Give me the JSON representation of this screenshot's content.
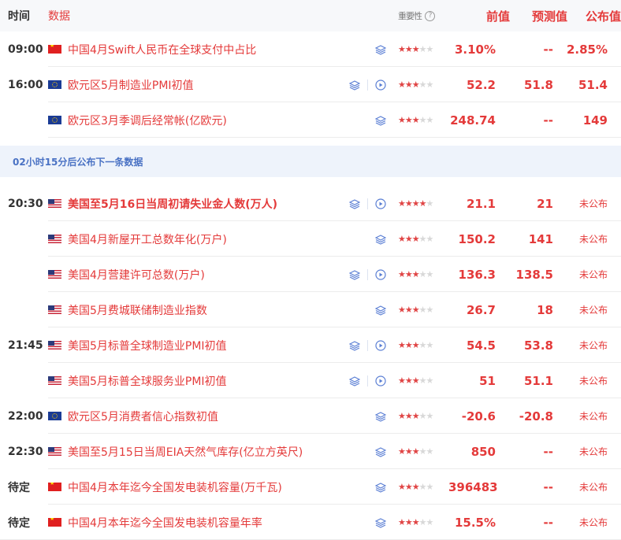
{
  "header": {
    "time": "时间",
    "data": "数据",
    "importance": "重要性",
    "importance_help": "?",
    "previous": "前值",
    "forecast": "预测值",
    "actual": "公布值"
  },
  "colors": {
    "accent_red": "#e43a3a",
    "banner_blue": "#4a72c4",
    "icon_blue": "#5b7fd4"
  },
  "group1": [
    {
      "time": "09:00",
      "flag": "cn",
      "name": "中国4月Swift人民币在全球支付中占比",
      "video": false,
      "stars": 3,
      "prev": "3.10%",
      "forecast": "--",
      "actual": "2.85%",
      "pending": false
    },
    {
      "time": "16:00",
      "flag": "eu",
      "name": "欧元区5月制造业PMI初值",
      "video": true,
      "stars": 3,
      "prev": "52.2",
      "forecast": "51.8",
      "actual": "51.4",
      "pending": false
    },
    {
      "time": "",
      "flag": "eu",
      "name": "欧元区3月季调后经常帐(亿欧元)",
      "video": false,
      "stars": 3,
      "prev": "248.74",
      "forecast": "--",
      "actual": "149",
      "pending": false
    }
  ],
  "banner": "02小时15分后公布下一条数据",
  "group2": [
    {
      "time": "20:30",
      "flag": "us",
      "name": "美国至5月16日当周初请失业金人数(万人)",
      "bold": true,
      "video": true,
      "stars": 4,
      "prev": "21.1",
      "forecast": "21",
      "actual": "未公布",
      "pending": true
    },
    {
      "time": "",
      "flag": "us",
      "name": "美国4月新屋开工总数年化(万户)",
      "video": false,
      "stars": 3,
      "prev": "150.2",
      "forecast": "141",
      "actual": "未公布",
      "pending": true
    },
    {
      "time": "",
      "flag": "us",
      "name": "美国4月营建许可总数(万户)",
      "video": true,
      "stars": 3,
      "prev": "136.3",
      "forecast": "138.5",
      "actual": "未公布",
      "pending": true
    },
    {
      "time": "",
      "flag": "us",
      "name": "美国5月费城联储制造业指数",
      "video": false,
      "stars": 3,
      "prev": "26.7",
      "forecast": "18",
      "actual": "未公布",
      "pending": true
    },
    {
      "time": "21:45",
      "flag": "us",
      "name": "美国5月标普全球制造业PMI初值",
      "video": true,
      "stars": 3,
      "prev": "54.5",
      "forecast": "53.8",
      "actual": "未公布",
      "pending": true
    },
    {
      "time": "",
      "flag": "us",
      "name": "美国5月标普全球服务业PMI初值",
      "video": true,
      "stars": 3,
      "prev": "51",
      "forecast": "51.1",
      "actual": "未公布",
      "pending": true
    },
    {
      "time": "22:00",
      "flag": "eu",
      "name": "欧元区5月消费者信心指数初值",
      "video": false,
      "stars": 3,
      "prev": "-20.6",
      "forecast": "-20.8",
      "actual": "未公布",
      "pending": true
    },
    {
      "time": "22:30",
      "flag": "us",
      "name": "美国至5月15日当周EIA天然气库存(亿立方英尺)",
      "video": false,
      "stars": 3,
      "prev": "850",
      "forecast": "--",
      "actual": "未公布",
      "pending": true
    },
    {
      "time": "待定",
      "flag": "cn",
      "name": "中国4月本年迄今全国发电装机容量(万千瓦)",
      "video": false,
      "stars": 3,
      "prev": "396483",
      "forecast": "--",
      "actual": "未公布",
      "pending": true
    },
    {
      "time": "待定",
      "flag": "cn",
      "name": "中国4月本年迄今全国发电装机容量年率",
      "video": false,
      "stars": 3,
      "prev": "15.5%",
      "forecast": "--",
      "actual": "未公布",
      "pending": true
    }
  ],
  "icons": {
    "layers": "layers-icon",
    "video": "play-circle-icon",
    "star": "star-icon",
    "help": "question-circle-icon"
  }
}
